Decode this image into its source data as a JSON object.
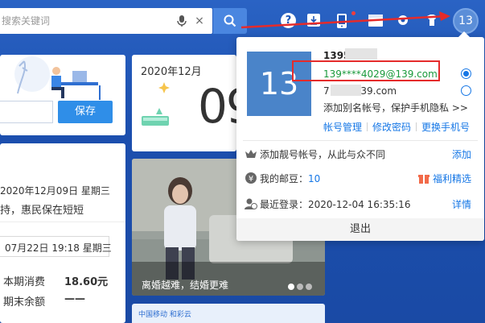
{
  "search": {
    "placeholder": "搜索关键词",
    "clear_glyph": "×"
  },
  "topbar": {
    "avatar_text": "13",
    "help_text": "?"
  },
  "illus_card": {
    "save_label": "保存"
  },
  "list_card": {
    "rows": [
      "2020年12月09日 星期三",
      "持，惠民保在短短",
      "07月22日 19:18 星期三"
    ],
    "bill": [
      {
        "label": "本期消费",
        "value": "18.60元"
      },
      {
        "label": "期末余额",
        "value": "——"
      }
    ]
  },
  "calendar_card": {
    "month_label": "2020年12月",
    "day": "09"
  },
  "photo_card": {
    "caption": "离婚越难，结婚更难"
  },
  "ad_card": {
    "text": "中国移动 和彩云"
  },
  "dropdown": {
    "avatar_text": "13",
    "main_account": "1395",
    "accounts": [
      {
        "text": "139****4029@139.com",
        "selected": true
      },
      {
        "text": "7      34@139.com",
        "selected": false
      }
    ],
    "alias_text": "添加别名帐号，保护手机隐私 >>",
    "links": [
      "帐号管理",
      "修改密码",
      "更换手机号"
    ],
    "rows": [
      {
        "icon": "crown-icon",
        "text": "添加靓号帐号，从此与众不同",
        "action": "添加"
      },
      {
        "icon": "coin-icon",
        "label": "我的邮豆：",
        "value": "10",
        "action": "福利精选"
      },
      {
        "icon": "user-clock-icon",
        "text": "最近登录：2020-12-04 16:35:16",
        "action": "详情"
      }
    ],
    "logout": "退出"
  },
  "colors": {
    "accent": "#1677e6",
    "selected_account": "#1a9a3c",
    "annotation": "#e52b2b",
    "header": "#1e57b8"
  }
}
